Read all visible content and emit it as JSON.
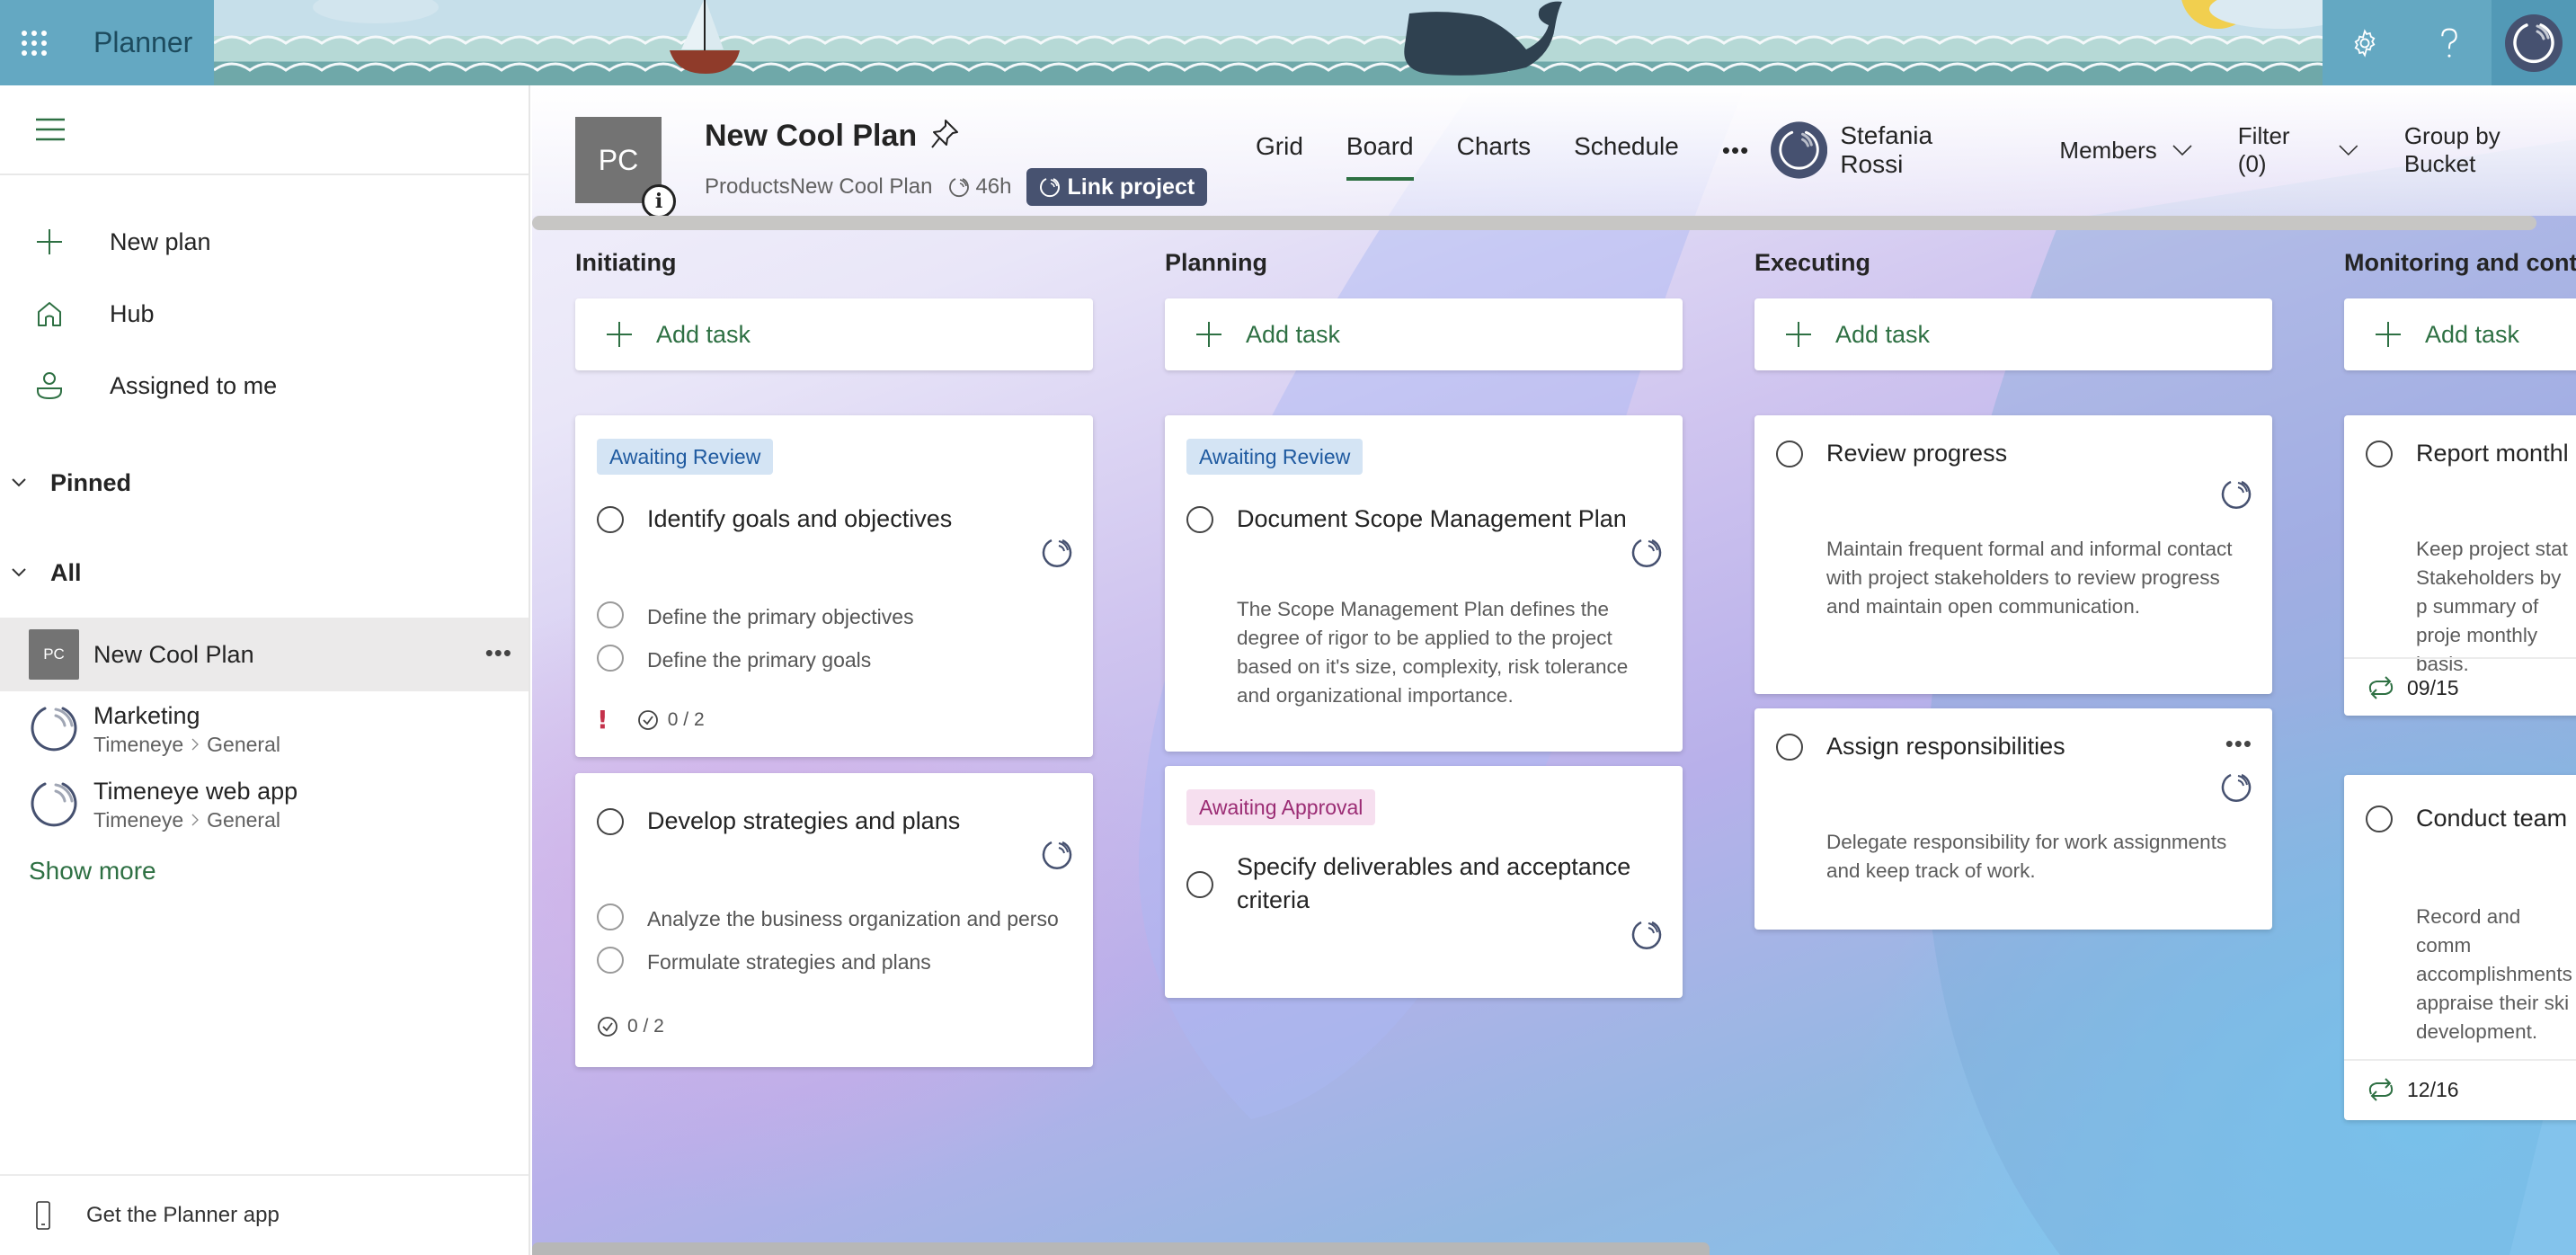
{
  "topbar": {
    "app_name": "Planner",
    "icons": [
      "waffle-icon",
      "gear-icon",
      "help-icon",
      "user-avatar"
    ]
  },
  "sidebar": {
    "nav": [
      {
        "label": "New plan",
        "icon": "plus-icon"
      },
      {
        "label": "Hub",
        "icon": "home-icon"
      },
      {
        "label": "Assigned to me",
        "icon": "person-icon"
      }
    ],
    "sections": {
      "pinned": "Pinned",
      "all": "All"
    },
    "plans": [
      {
        "initials": "PC",
        "name": "New Cool Plan",
        "active": true
      },
      {
        "name": "Marketing",
        "team": "Timeneye",
        "channel": "General"
      },
      {
        "name": "Timeneye web app",
        "team": "Timeneye",
        "channel": "General"
      }
    ],
    "show_more": "Show more",
    "footer": "Get the Planner app"
  },
  "plan": {
    "initials": "PC",
    "title": "New Cool Plan",
    "group": "ProductsNew Cool Plan",
    "hours": "46h",
    "link_button": "Link project",
    "tabs": [
      {
        "label": "Grid",
        "active": false
      },
      {
        "label": "Board",
        "active": true
      },
      {
        "label": "Charts",
        "active": false
      },
      {
        "label": "Schedule",
        "active": false
      }
    ],
    "more": "•••",
    "user": "Stefania Rossi",
    "members": "Members",
    "filter": "Filter (0)",
    "group_by": "Group by Bucket"
  },
  "colors": {
    "accent_green": "#2e7043",
    "link_button_bg": "#475270",
    "label_review_bg": "#d4e4f4",
    "label_review_text": "#1f5aa0",
    "label_approval_bg": "#f6dfef",
    "label_approval_text": "#9b2c74",
    "priority_red": "#c4314b"
  },
  "board": {
    "add_task": "Add task",
    "buckets": [
      {
        "name": "Initiating",
        "tasks": [
          {
            "label": "Awaiting Review",
            "title": "Identify goals and objectives",
            "checklist": [
              "Define the primary objectives",
              "Define the primary goals"
            ],
            "priority": "!",
            "progress": "0 / 2"
          },
          {
            "title": "Develop strategies and plans",
            "checklist": [
              "Analyze the business organization and perso",
              "Formulate strategies and plans"
            ],
            "progress": "0 / 2"
          }
        ]
      },
      {
        "name": "Planning",
        "tasks": [
          {
            "label": "Awaiting Review",
            "title": "Document Scope Management Plan",
            "description": "The Scope Management Plan defines the degree of rigor to be applied to the project based on it's size, complexity, risk tolerance and organizational importance."
          },
          {
            "label": "Awaiting Approval",
            "title": "Specify deliverables and acceptance criteria"
          }
        ]
      },
      {
        "name": "Executing",
        "tasks": [
          {
            "title": "Review progress",
            "description": "Maintain frequent formal and informal contact with project stakeholders to review progress and maintain open communication."
          },
          {
            "title": "Assign responsibilities",
            "description": "Delegate responsibility for work assignments and keep track of work.",
            "more": "•••"
          }
        ]
      },
      {
        "name": "Monitoring and cont",
        "tasks": [
          {
            "title": "Report monthl",
            "description": "Keep project stat Stakeholders by p summary of proje monthly basis.",
            "recurring_date": "09/15"
          },
          {
            "title": "Conduct team",
            "description": "Record and comm accomplishments appraise their ski development.",
            "recurring_date": "12/16"
          }
        ]
      }
    ]
  }
}
